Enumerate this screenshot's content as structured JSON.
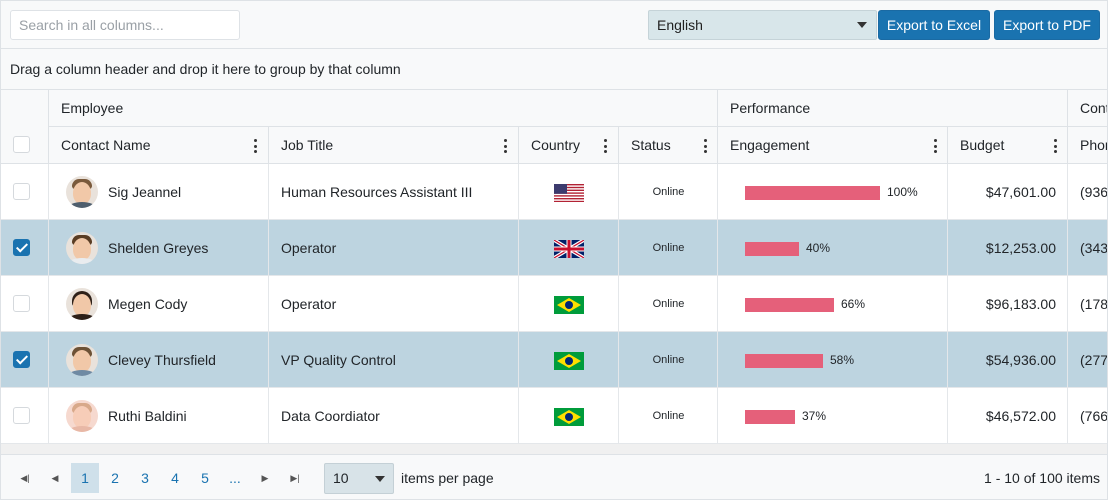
{
  "toolbar": {
    "search_placeholder": "Search in all columns...",
    "language": "English",
    "export_excel": "Export to Excel",
    "export_pdf": "Export to PDF"
  },
  "grouping_hint": "Drag a column header and drop it here to group by that column",
  "bands": {
    "employee": "Employee",
    "performance": "Performance",
    "contact": "Cont"
  },
  "columns": {
    "contact_name": "Contact Name",
    "job_title": "Job Title",
    "country": "Country",
    "status": "Status",
    "engagement": "Engagement",
    "budget": "Budget",
    "phone": "Phon"
  },
  "rows": [
    {
      "name": "Sig Jeannel",
      "job": "Human Resources Assistant III",
      "country_flag": "us-flag",
      "status": "Online",
      "engagement": 100,
      "engagement_label": "100%",
      "budget": "$47,601.00",
      "phone": "(936",
      "selected": false
    },
    {
      "name": "Shelden Greyes",
      "job": "Operator",
      "country_flag": "uk-flag",
      "status": "Online",
      "engagement": 40,
      "engagement_label": "40%",
      "budget": "$12,253.00",
      "phone": "(343",
      "selected": true
    },
    {
      "name": "Megen Cody",
      "job": "Operator",
      "country_flag": "brazil-flag",
      "status": "Online",
      "engagement": 66,
      "engagement_label": "66%",
      "budget": "$96,183.00",
      "phone": "(178",
      "selected": false
    },
    {
      "name": "Clevey Thursfield",
      "job": "VP Quality Control",
      "country_flag": "brazil-flag",
      "status": "Online",
      "engagement": 58,
      "engagement_label": "58%",
      "budget": "$54,936.00",
      "phone": "(277",
      "selected": true
    },
    {
      "name": "Ruthi Baldini",
      "job": "Data Coordiator",
      "country_flag": "brazil-flag",
      "status": "Online",
      "engagement": 37,
      "engagement_label": "37%",
      "budget": "$46,572.00",
      "phone": "(766",
      "selected": false
    }
  ],
  "pager": {
    "pages": [
      "1",
      "2",
      "3",
      "4",
      "5",
      "..."
    ],
    "current_page": "1",
    "page_size": "10",
    "items_per_page_label": "items per page",
    "info": "1 - 10 of 100 items"
  },
  "colors": {
    "accent": "#1a73b0",
    "selected_row": "#bdd4e0",
    "engagement_bar": "#e5607a"
  }
}
